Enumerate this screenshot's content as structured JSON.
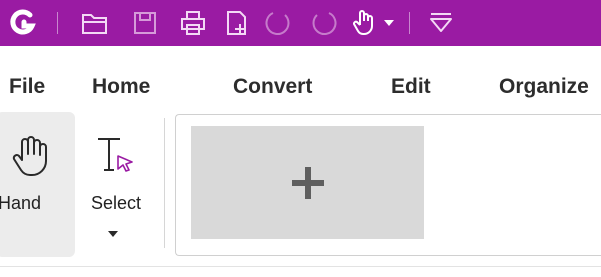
{
  "quick_access": {
    "icons": [
      "app-logo-icon",
      "open-folder-icon",
      "save-icon",
      "print-icon",
      "new-file-icon",
      "undo-icon",
      "redo-icon",
      "hand-mode-icon",
      "dropdown-arrow-icon",
      "customize-qat-icon"
    ],
    "background_color": "#9a1ba3"
  },
  "menu": {
    "tabs": [
      "File",
      "Home",
      "Convert",
      "Edit",
      "Organize"
    ]
  },
  "ribbon": {
    "hand_label": "Hand",
    "select_label": "Select",
    "add_tile_icon": "plus-icon"
  }
}
